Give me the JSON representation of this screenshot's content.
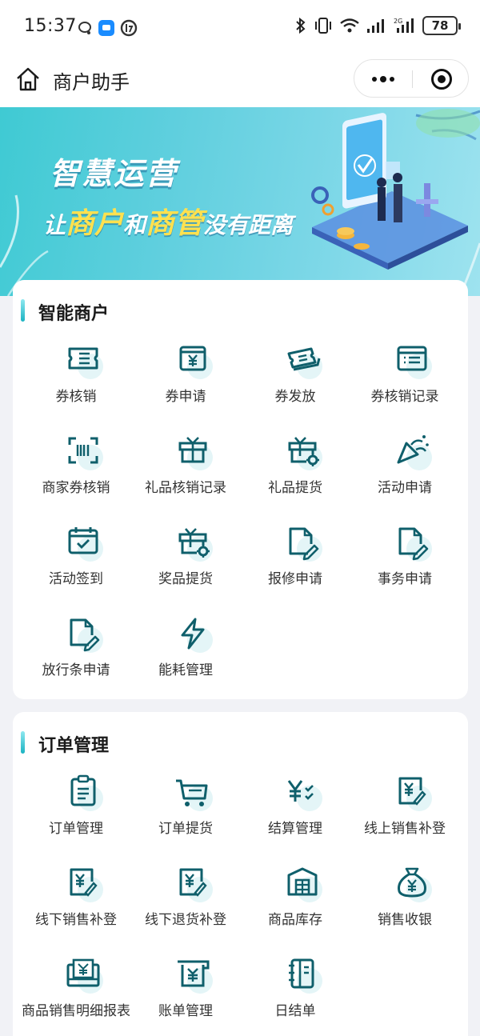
{
  "status_bar": {
    "time": "15:37",
    "battery": "78"
  },
  "nav": {
    "title": "商户助手"
  },
  "banner": {
    "line1": "智慧运营",
    "line2_a": "让",
    "line2_b": "商户",
    "line2_c": "和",
    "line2_d": "商管",
    "line2_e": "没有距离"
  },
  "sections": [
    {
      "title": "智能商户",
      "items": [
        {
          "label": "券核销",
          "icon": "coupon-icon"
        },
        {
          "label": "券申请",
          "icon": "yen-box-icon"
        },
        {
          "label": "券发放",
          "icon": "tickets-icon"
        },
        {
          "label": "券核销记录",
          "icon": "list-window-icon"
        },
        {
          "label": "商家券核销",
          "icon": "scan-icon"
        },
        {
          "label": "礼品核销记录",
          "icon": "gift-icon"
        },
        {
          "label": "礼品提货",
          "icon": "gift-gear-icon"
        },
        {
          "label": "活动申请",
          "icon": "party-popper-icon"
        },
        {
          "label": "活动签到",
          "icon": "calendar-check-icon"
        },
        {
          "label": "奖品提货",
          "icon": "prize-gear-icon"
        },
        {
          "label": "报修申请",
          "icon": "doc-edit-icon"
        },
        {
          "label": "事务申请",
          "icon": "doc-edit-icon"
        },
        {
          "label": "放行条申请",
          "icon": "doc-edit-icon"
        },
        {
          "label": "能耗管理",
          "icon": "lightning-icon"
        }
      ]
    },
    {
      "title": "订单管理",
      "items": [
        {
          "label": "订单管理",
          "icon": "clipboard-icon"
        },
        {
          "label": "订单提货",
          "icon": "cart-icon"
        },
        {
          "label": "结算管理",
          "icon": "yen-check-icon"
        },
        {
          "label": "线上销售补登",
          "icon": "yen-doc-icon"
        },
        {
          "label": "线下销售补登",
          "icon": "yen-doc-icon"
        },
        {
          "label": "线下退货补登",
          "icon": "yen-doc-icon"
        },
        {
          "label": "商品库存",
          "icon": "warehouse-icon"
        },
        {
          "label": "销售收银",
          "icon": "money-bag-icon"
        },
        {
          "label": "商品销售明细报表",
          "icon": "report-icon"
        },
        {
          "label": "账单管理",
          "icon": "bill-icon"
        },
        {
          "label": "日结单",
          "icon": "notebook-icon"
        }
      ]
    }
  ]
}
